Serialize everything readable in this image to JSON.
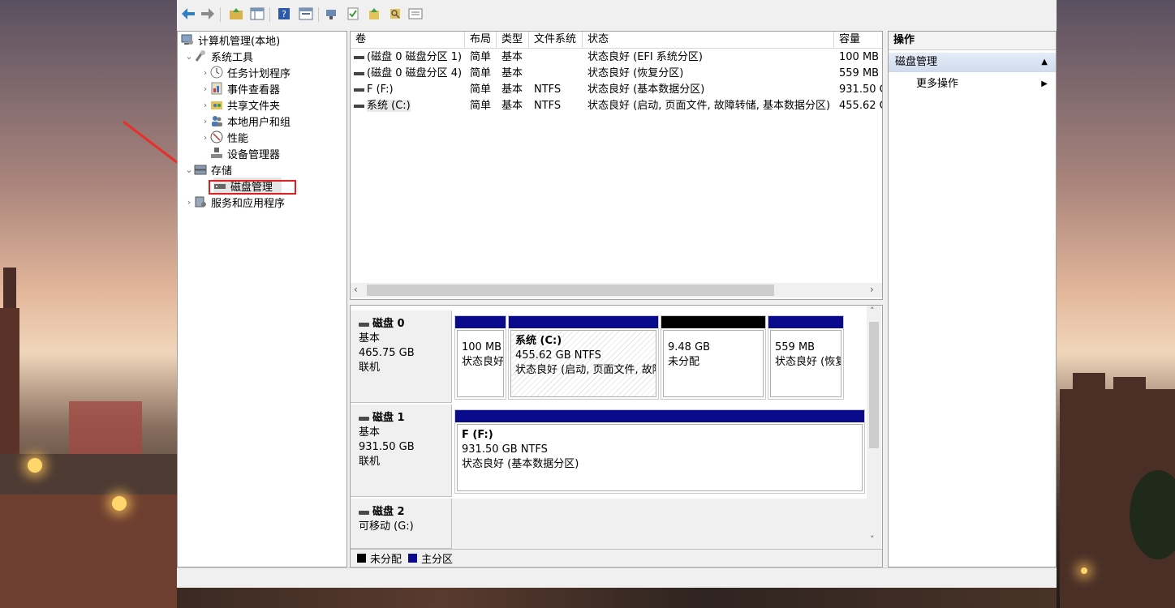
{
  "toolbar": {
    "buttons": [
      "back-icon",
      "forward-icon",
      "up-folder-icon",
      "show-hide-tree-icon",
      "help-icon",
      "properties-icon",
      "connect-icon",
      "checklist-icon",
      "export-icon",
      "search-icon",
      "console-icon"
    ]
  },
  "tree": {
    "root": "计算机管理(本地)",
    "system_tools": "系统工具",
    "task_scheduler": "任务计划程序",
    "event_viewer": "事件查看器",
    "shared_folders": "共享文件夹",
    "local_users": "本地用户和组",
    "performance": "性能",
    "device_manager": "设备管理器",
    "storage": "存储",
    "disk_management": "磁盘管理",
    "services": "服务和应用程序"
  },
  "list": {
    "headers": {
      "volume": "卷",
      "layout": "布局",
      "type": "类型",
      "fs": "文件系统",
      "status": "状态",
      "capacity": "容量"
    },
    "rows": [
      {
        "volume": "(磁盘 0 磁盘分区 1)",
        "layout": "简单",
        "type": "基本",
        "fs": "",
        "status": "状态良好 (EFI 系统分区)",
        "capacity": "100 MB"
      },
      {
        "volume": "(磁盘 0 磁盘分区 4)",
        "layout": "简单",
        "type": "基本",
        "fs": "",
        "status": "状态良好 (恢复分区)",
        "capacity": "559 MB"
      },
      {
        "volume": "F (F:)",
        "layout": "简单",
        "type": "基本",
        "fs": "NTFS",
        "status": "状态良好 (基本数据分区)",
        "capacity": "931.50 G"
      },
      {
        "volume": "系统 (C:)",
        "layout": "简单",
        "type": "基本",
        "fs": "NTFS",
        "status": "状态良好 (启动, 页面文件, 故障转储, 基本数据分区)",
        "capacity": "455.62 G"
      }
    ]
  },
  "disks": {
    "disk0": {
      "name": "磁盘 0",
      "type": "基本",
      "size": "465.75 GB",
      "state": "联机",
      "partitions": [
        {
          "line1": "",
          "line2": "100 MB",
          "line3": "状态良好",
          "kind": "primary"
        },
        {
          "line1": "系统 (C:)",
          "line2": "455.62 GB NTFS",
          "line3": "状态良好 (启动, 页面文件, 故障",
          "kind": "primary"
        },
        {
          "line1": "",
          "line2": "9.48 GB",
          "line3": "未分配",
          "kind": "unallocated"
        },
        {
          "line1": "",
          "line2": "559 MB",
          "line3": "状态良好 (恢复",
          "kind": "primary"
        }
      ]
    },
    "disk1": {
      "name": "磁盘 1",
      "type": "基本",
      "size": "931.50 GB",
      "state": "联机",
      "partition": {
        "line1": "F (F:)",
        "line2": "931.50 GB NTFS",
        "line3": "状态良好 (基本数据分区)"
      }
    },
    "disk2": {
      "name": "磁盘 2",
      "type": "可移动 (G:)"
    }
  },
  "legend": {
    "unallocated": "未分配",
    "primary": "主分区"
  },
  "actions": {
    "title": "操作",
    "section": "磁盘管理",
    "more": "更多操作"
  },
  "colors": {
    "primary": "#0a0a8c",
    "unallocated": "#000000",
    "highlight_box": "#e02020",
    "annotation_arrow": "#e8302a"
  }
}
